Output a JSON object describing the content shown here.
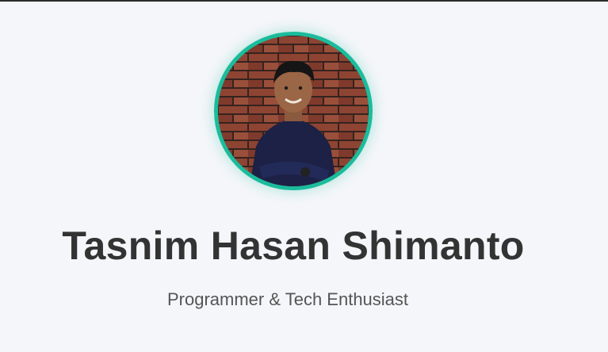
{
  "profile": {
    "name": "Tasnim Hasan Shimanto",
    "tagline": "Programmer & Tech Enthusiast",
    "avatar": {
      "icon": "profile-photo",
      "border_color": "#1abc9c"
    }
  },
  "colors": {
    "background": "#f5f6fa",
    "name_text": "#333333",
    "tagline_text": "#555555",
    "accent": "#1abc9c"
  }
}
